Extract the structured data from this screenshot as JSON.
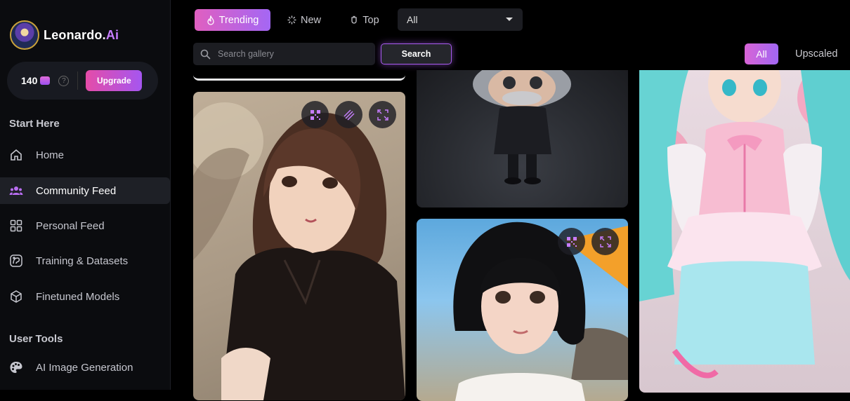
{
  "brand": {
    "name": "Leonardo.",
    "accent": "Ai"
  },
  "credits": {
    "count": "140",
    "upgrade_label": "Upgrade",
    "help": "?"
  },
  "sidebar": {
    "section_start": "Start Here",
    "section_tools": "User Tools",
    "items": [
      {
        "label": "Home",
        "icon": "home-icon"
      },
      {
        "label": "Community Feed",
        "icon": "community-icon"
      },
      {
        "label": "Personal Feed",
        "icon": "grid-icon"
      },
      {
        "label": "Training & Datasets",
        "icon": "training-icon"
      },
      {
        "label": "Finetuned Models",
        "icon": "cube-icon"
      },
      {
        "label": "AI Image Generation",
        "icon": "palette-icon"
      }
    ]
  },
  "toolbar": {
    "trending_label": "Trending",
    "new_label": "New",
    "top_label": "Top",
    "select_value": "All",
    "search_placeholder": "Search gallery",
    "search_button": "Search",
    "filter_all": "All",
    "filter_upscaled": "Upscaled"
  },
  "colors": {
    "accent": "#a556f0",
    "brand_pink": "#e54ca8",
    "background": "#000000",
    "sidebar": "#0b0c0f"
  }
}
